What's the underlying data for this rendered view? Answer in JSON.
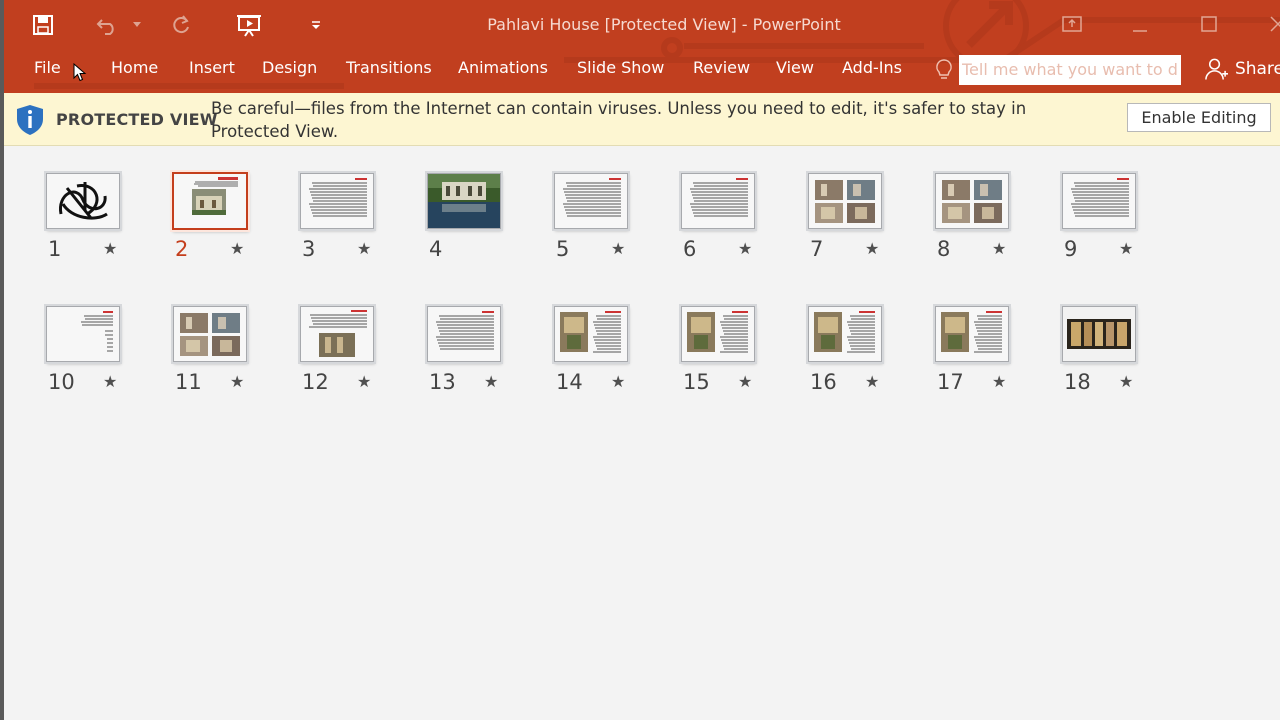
{
  "window": {
    "title": "Pahlavi House [Protected View] - PowerPoint"
  },
  "quick_access": {
    "icons": [
      "save-icon",
      "undo-icon",
      "redo-icon",
      "present-icon",
      "customize-icon"
    ]
  },
  "ribbon": {
    "tabs": [
      {
        "label": "File"
      },
      {
        "label": "Home"
      },
      {
        "label": "Insert"
      },
      {
        "label": "Design"
      },
      {
        "label": "Transitions"
      },
      {
        "label": "Animations"
      },
      {
        "label": "Slide Show"
      },
      {
        "label": "Review"
      },
      {
        "label": "View"
      },
      {
        "label": "Add-Ins"
      }
    ],
    "tell_me_placeholder": "Tell me what you want to do",
    "share_label": "Share"
  },
  "protected_view": {
    "title": "PROTECTED VIEW",
    "message": "Be careful—files from the Internet can contain viruses. Unless you need to edit, it's safer to stay in Protected View.",
    "enable_label": "Enable Editing"
  },
  "slides": [
    {
      "num": "1",
      "kind": "calligraphy",
      "star": "★"
    },
    {
      "num": "2",
      "kind": "photo-text",
      "star": "★",
      "selected": true
    },
    {
      "num": "3",
      "kind": "text",
      "star": "★"
    },
    {
      "num": "4",
      "kind": "photo-full",
      "star": ""
    },
    {
      "num": "5",
      "kind": "text",
      "star": "★"
    },
    {
      "num": "6",
      "kind": "text",
      "star": "★"
    },
    {
      "num": "7",
      "kind": "photo-grid",
      "star": "★"
    },
    {
      "num": "8",
      "kind": "photo-grid",
      "star": "★"
    },
    {
      "num": "9",
      "kind": "text",
      "star": "★"
    },
    {
      "num": "10",
      "kind": "text-sparse",
      "star": "★"
    },
    {
      "num": "11",
      "kind": "photo-grid",
      "star": "★"
    },
    {
      "num": "12",
      "kind": "text-photo-bottom",
      "star": "★"
    },
    {
      "num": "13",
      "kind": "text",
      "star": "★"
    },
    {
      "num": "14",
      "kind": "photo-left-text",
      "star": "★"
    },
    {
      "num": "15",
      "kind": "photo-left-text",
      "star": "★"
    },
    {
      "num": "16",
      "kind": "photo-left-text",
      "star": "★"
    },
    {
      "num": "17",
      "kind": "photo-left-text",
      "star": "★"
    },
    {
      "num": "18",
      "kind": "photo-strip",
      "star": "★"
    }
  ],
  "colors": {
    "accent": "#c13f1f",
    "protected_bar": "#fdf6d2",
    "selected_border": "#c43e1c"
  }
}
